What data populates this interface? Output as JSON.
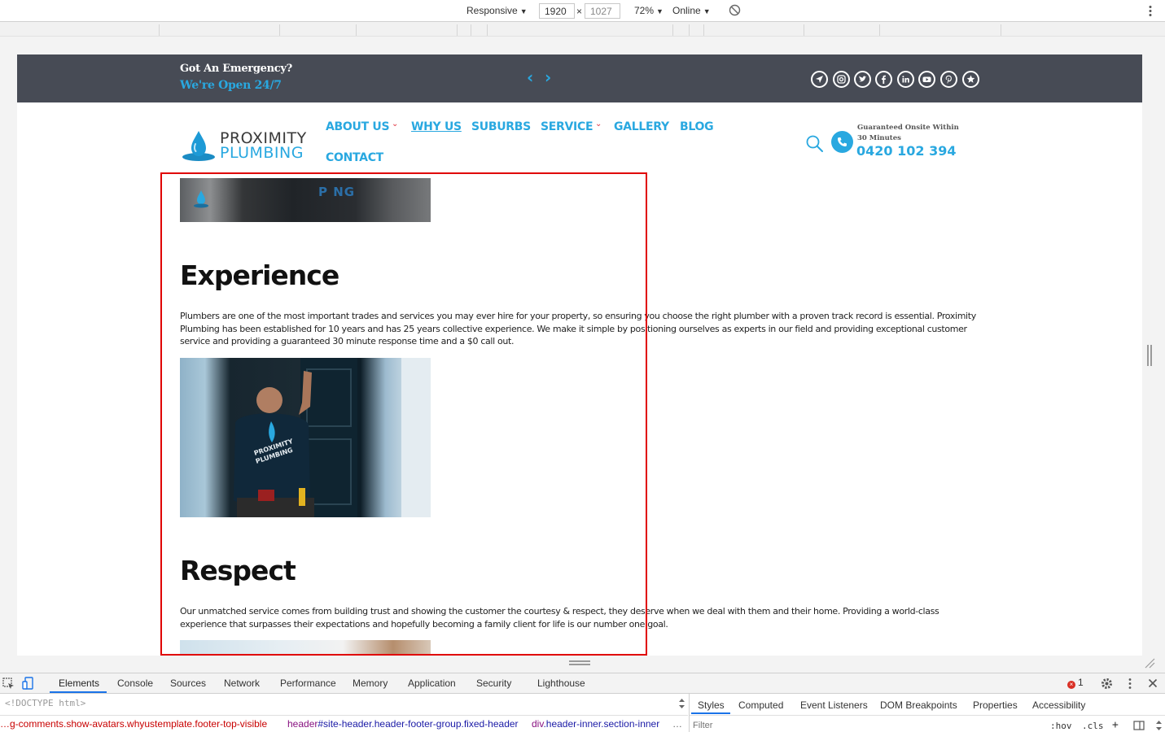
{
  "device_toolbar": {
    "mode": "Responsive",
    "width": "1920",
    "height": "1027",
    "separator": "×",
    "zoom": "72%",
    "network": "Online"
  },
  "site": {
    "topbar": {
      "line1": "Got An Emergency?",
      "line2": "We're Open 24/7",
      "prev_arrow": "‹",
      "next_arrow": "›",
      "social_icons": [
        "location-arrow-icon",
        "instagram-icon",
        "twitter-icon",
        "facebook-icon",
        "linkedin-icon",
        "youtube-icon",
        "pinterest-icon",
        "star-icon"
      ]
    },
    "logo": {
      "line1": "PROXIMITY",
      "line2": "PLUMBING"
    },
    "nav": {
      "about": "ABOUT US",
      "why": "WHY US",
      "suburbs": "SUBURBS",
      "service": "SERVICE",
      "gallery": "GALLERY",
      "blog": "BLOG",
      "contact": "CONTACT",
      "caret": "⌄"
    },
    "contact": {
      "guarantee": "Guaranteed Onsite Within 30 Minutes",
      "phone": "0420 102 394"
    },
    "sections": [
      {
        "heading": "Experience",
        "text": "Plumbers are one of the most important trades and services you may ever hire for your property, so ensuring you choose the right plumber with a proven track record is essential. Proximity Plumbing has been established for 10 years and has 25 years collective experience. We make it simple by positioning ourselves as experts in our field and providing exceptional customer service and providing a guaranteed 30 minute response time and a $0 call out."
      },
      {
        "heading": "Respect",
        "text": "Our unmatched service comes from building trust and showing the customer the courtesy & respect, they deserve when we deal with them and their home. Providing a world-class experience that surpasses their expectations and hopefully becoming a family client for life is our number one goal."
      }
    ],
    "photo_text": "P NG"
  },
  "devtools": {
    "tabs": [
      "Elements",
      "Console",
      "Sources",
      "Network",
      "Performance",
      "Memory",
      "Application",
      "Security",
      "Lighthouse"
    ],
    "error_count": "1",
    "dom_line": "<!DOCTYPE html>",
    "breadcrumbs": {
      "first": "…g-comments.show-avatars.whyustemplate.footer-top-visible",
      "second_tag": "header",
      "second_rest": "#site-header.header-footer-group.fixed-header",
      "third_tag": "div",
      "third_rest": ".header-inner.section-inner",
      "more": "…"
    },
    "styles_tabs": [
      "Styles",
      "Computed",
      "Event Listeners",
      "DOM Breakpoints",
      "Properties",
      "Accessibility"
    ],
    "filter_placeholder": "Filter",
    "hov": ":hov",
    "cls": ".cls",
    "plus": "+"
  },
  "colors": {
    "accent": "#29a8e0",
    "topbar": "#474b55",
    "highlight": "#e00000"
  }
}
